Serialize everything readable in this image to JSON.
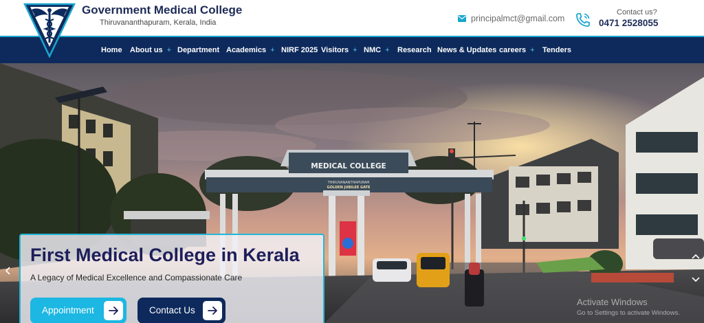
{
  "header": {
    "college_name": "Government Medical College",
    "location": "Thiruvananthapuram, Kerala, India",
    "email": "principalmct@gmail.com",
    "contact_prompt": "Contact us?",
    "phone": "0471 2528055"
  },
  "nav": {
    "items": [
      {
        "label": "Home",
        "has_submenu": false
      },
      {
        "label": "About us",
        "has_submenu": true
      },
      {
        "label": "Department",
        "has_submenu": false
      },
      {
        "label": "Academics",
        "has_submenu": true
      },
      {
        "label": "NIRF 2025",
        "has_submenu": false
      },
      {
        "label": "Visitors",
        "has_submenu": true
      },
      {
        "label": "NMC",
        "has_submenu": true
      },
      {
        "label": "Research",
        "has_submenu": false
      },
      {
        "label": "News & Updates",
        "has_submenu": false
      },
      {
        "label": "careers",
        "has_submenu": true
      },
      {
        "label": "Tenders",
        "has_submenu": false
      }
    ],
    "submenu_symbol": "+"
  },
  "hero": {
    "gate_title": "MEDICAL COLLEGE",
    "gate_sub1": "THIRUVANANTHAPURAM",
    "gate_sub2": "GOLDEN JUBILEE GATE",
    "headline": "First Medical College in Kerala",
    "tagline": "A Legacy of Medical Excellence and Compassionate Care",
    "appointment_label": "Appointment",
    "contact_label": "Contact Us"
  },
  "system": {
    "watermark_title": "Activate Windows",
    "watermark_sub": "Go to Settings to activate Windows."
  },
  "colors": {
    "navy": "#0e2a5c",
    "accent": "#1cb7e2",
    "title": "#1d1e5a"
  },
  "icons": {
    "mail": "mail-icon",
    "phone": "phone-icon",
    "arrow": "arrow-right-icon",
    "logo": "caduceus-logo"
  }
}
